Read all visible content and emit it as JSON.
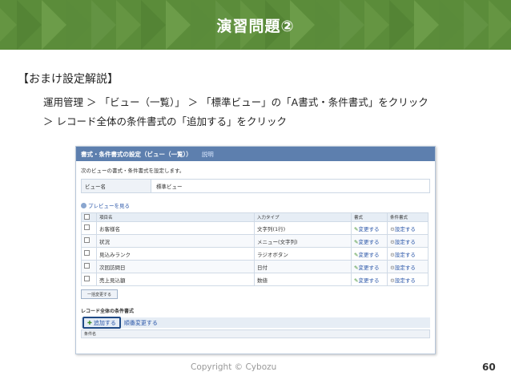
{
  "slide": {
    "title": "演習問題②",
    "section_title": "【おまけ設定解説】",
    "line1": "運用管理 ＞ 「ビュー（一覧）」 ＞ 「標準ビュー」の「A書式・条件書式」をクリック",
    "line2": "＞ レコード全体の条件書式の「追加する」をクリック",
    "footer": "Copyright © Cybozu",
    "page_number": "60",
    "banner_color": "#5b8c3a"
  },
  "screenshot": {
    "header_title": "書式・条件書式の設定（ビュー（一覧））",
    "header_help": "説明",
    "description": "次のビューの書式・条件書式を設定します。",
    "view_name_label": "ビュー名",
    "view_name_value": "標準ビュー",
    "preview_link": "プレビューを見る",
    "columns": [
      "項目名",
      "入力タイプ",
      "書式",
      "条件書式"
    ],
    "rows": [
      {
        "name": "お客様名",
        "type": "文字列(1行)",
        "format": "変更する",
        "cond": "設定する"
      },
      {
        "name": "状況",
        "type": "メニュー(文字列)",
        "format": "変更する",
        "cond": "設定する"
      },
      {
        "name": "見込みランク",
        "type": "ラジオボタン",
        "format": "変更する",
        "cond": "設定する"
      },
      {
        "name": "次回訪問日",
        "type": "日付",
        "format": "変更する",
        "cond": "設定する"
      },
      {
        "name": "売上見込額",
        "type": "数値",
        "format": "変更する",
        "cond": "設定する"
      }
    ],
    "bulk_button": "一括変更する",
    "record_section": "レコード全体の条件書式",
    "add_button": "追加する",
    "order_button": "順番変更する",
    "condition_header": "条件名",
    "accent_link_color": "#2a56a8",
    "header_color": "#5d7fae"
  }
}
